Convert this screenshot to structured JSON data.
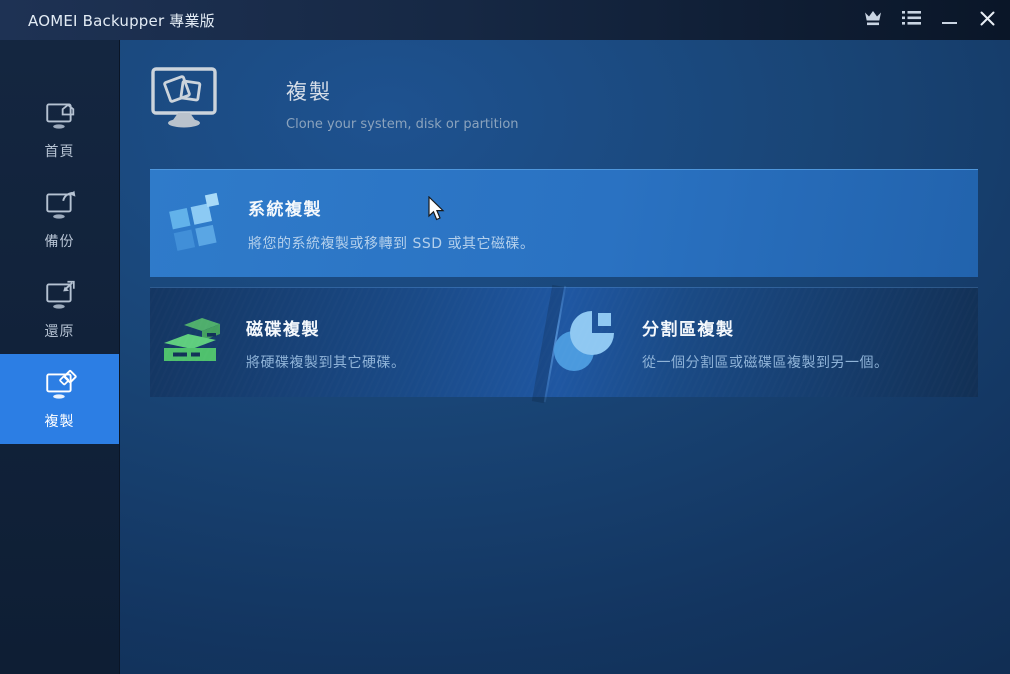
{
  "titlebar": {
    "title": "AOMEI Backupper 專業版",
    "icons": [
      "crown-upgrade-icon",
      "menu-list-icon",
      "minimize-icon",
      "close-icon"
    ]
  },
  "sidebar": {
    "items": [
      {
        "label": "首頁",
        "icon": "monitor-home-icon",
        "selected": false
      },
      {
        "label": "備份",
        "icon": "monitor-backup-icon",
        "selected": false
      },
      {
        "label": "還原",
        "icon": "monitor-restore-icon",
        "selected": false
      },
      {
        "label": "複製",
        "icon": "monitor-clone-icon",
        "selected": true
      }
    ]
  },
  "header": {
    "title": "複製",
    "subtitle": "Clone your system, disk or partition",
    "icon": "clone-monitor-icon"
  },
  "options": [
    {
      "title": "系統複製",
      "description": "將您的系統複製或移轉到 SSD 或其它磁碟。",
      "icon": "windows-logo-icon",
      "state": "hovered"
    },
    {
      "title": "磁碟複製",
      "description": "將硬碟複製到其它硬碟。",
      "icon": "disk-stack-icon",
      "state": "normal"
    },
    {
      "title": "分割區複製",
      "description": "從一個分割區或磁碟區複製到另一個。",
      "icon": "pie-partition-icon",
      "state": "normal"
    }
  ],
  "colors": {
    "accent_selected": "#2c7ee4",
    "hover_row_blue": "#2a72c2",
    "titlebar_bg": "#162844",
    "sidebar_bg": "#0e1e34",
    "disk_icon_green": "#4fc16d",
    "partition_icon_blue": "#8fc8f2",
    "windows_icon_blue": "#8ccaf4"
  }
}
